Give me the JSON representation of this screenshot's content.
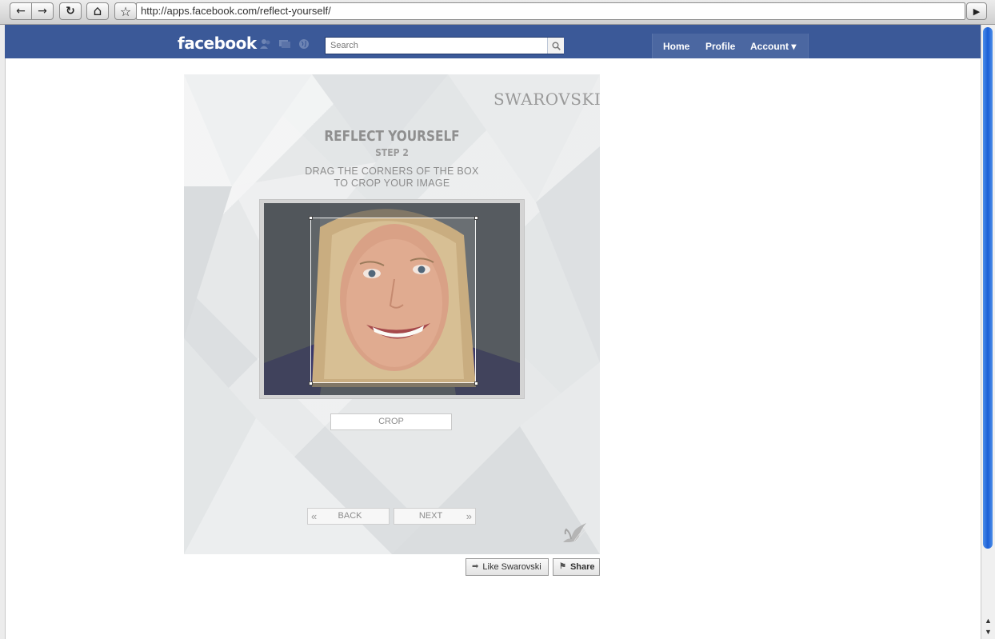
{
  "browser": {
    "url": "http://apps.facebook.com/reflect-yourself/",
    "back_glyph": "←",
    "forward_glyph": "→",
    "reload_glyph": "↻",
    "home_glyph": "⌂",
    "bookmark_glyph": "☆",
    "menu_glyph": "▶"
  },
  "facebook": {
    "logo": "facebook",
    "search_placeholder": "Search",
    "nav": {
      "home": "Home",
      "profile": "Profile",
      "account": "Account ▾"
    }
  },
  "app": {
    "brand": "SWAROVSKI",
    "title": "REFLECT YOURSELF",
    "step": "STEP 2",
    "instruction_line1": "DRAG THE CORNERS OF THE BOX",
    "instruction_line2": "TO CROP YOUR IMAGE",
    "crop_label": "CROP",
    "back_label": "BACK",
    "next_label": "NEXT",
    "back_chevron": "«",
    "next_chevron": "»"
  },
  "actions": {
    "like_label": "Like Swarovski",
    "share_label": "Share"
  },
  "colors": {
    "facebook_blue": "#3b5998",
    "scroll_blue": "#1b5fd6"
  }
}
